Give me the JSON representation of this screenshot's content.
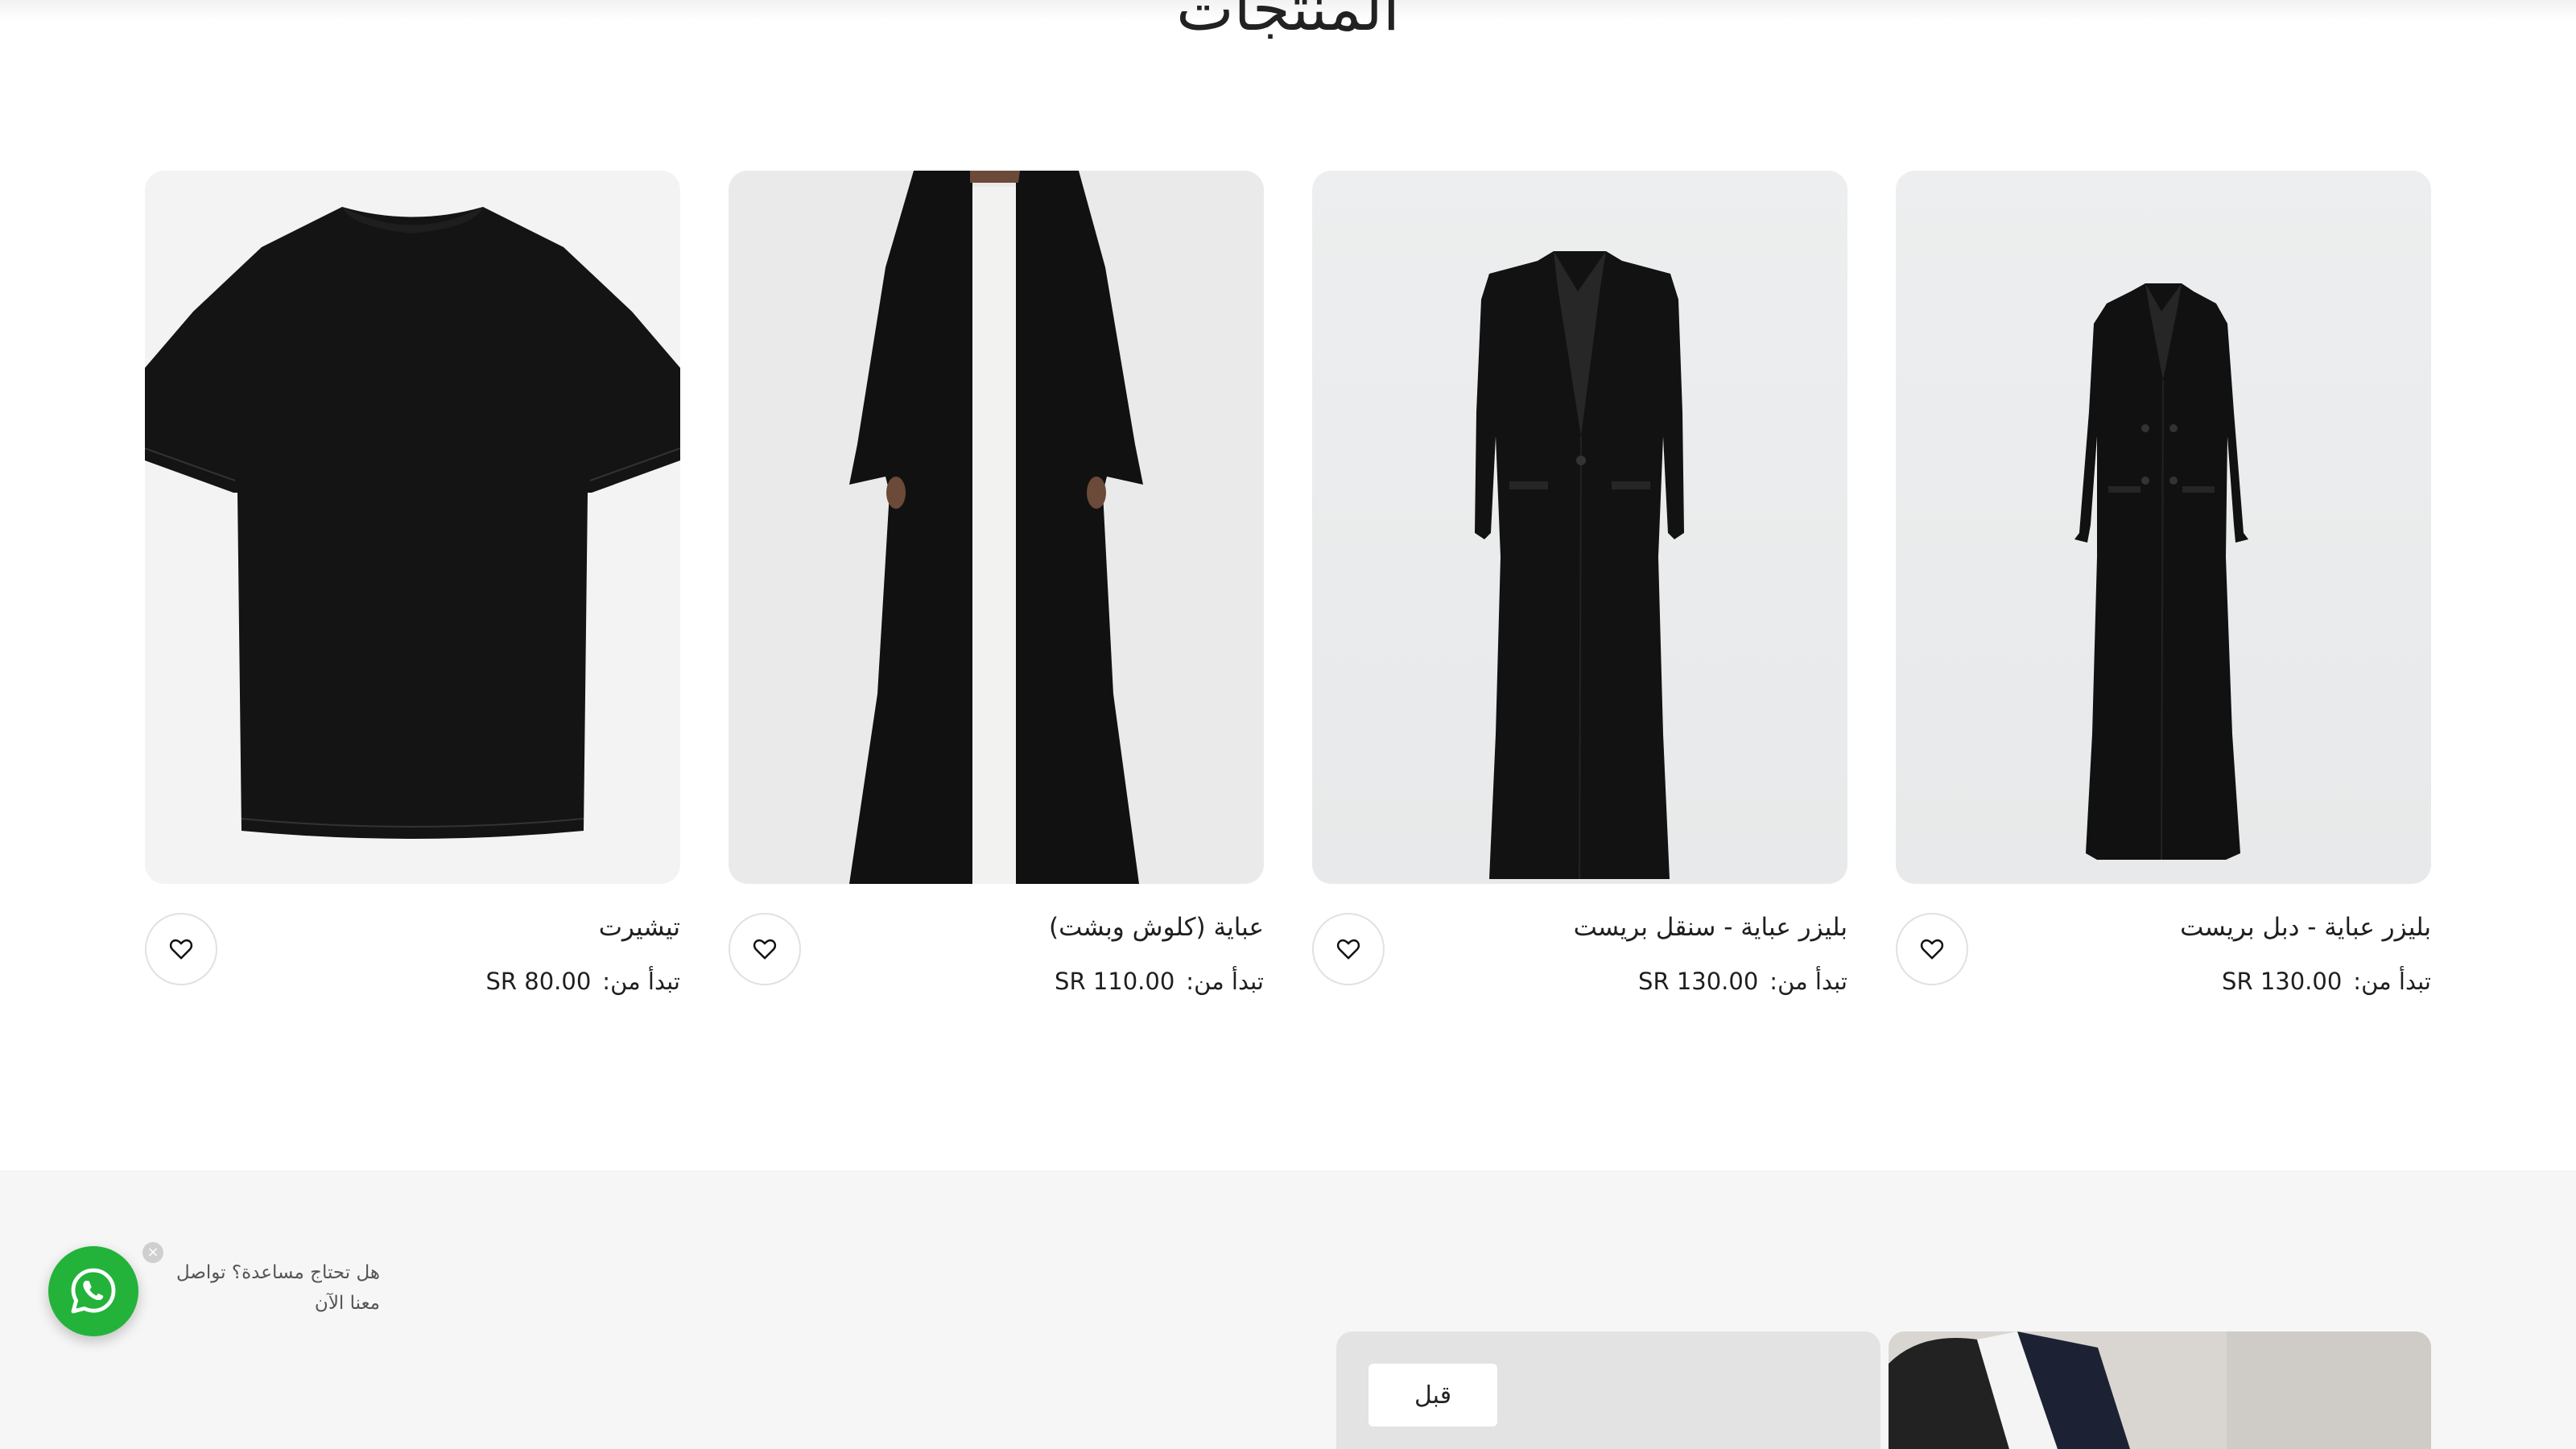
{
  "section": {
    "title": "المنتجات"
  },
  "price_prefix": "تبدأ من:",
  "products": [
    {
      "name": "بليزر عباية - دبل بريست",
      "price": "SR 130.00",
      "image": "double-breasted-blazer-abaya"
    },
    {
      "name": "بليزر عباية - سنقل بريست",
      "price": "SR 130.00",
      "image": "single-breasted-blazer-abaya"
    },
    {
      "name": "عباية (كلوش وبشت)",
      "price": "SR 110.00",
      "image": "flared-bisht-abaya"
    },
    {
      "name": "تيشيرت",
      "price": "SR 80.00",
      "image": "black-tshirt"
    }
  ],
  "slider": {
    "prev_label": "قبل"
  },
  "whatsapp": {
    "message": "هل تحتاج مساعدة؟ تواصل معنا الآن",
    "close_label": "×",
    "icon": "whatsapp-icon",
    "color": "#23b33a"
  },
  "colors": {
    "lower_section_bg": "#f6f6f6",
    "card_bg": "#ececec"
  }
}
